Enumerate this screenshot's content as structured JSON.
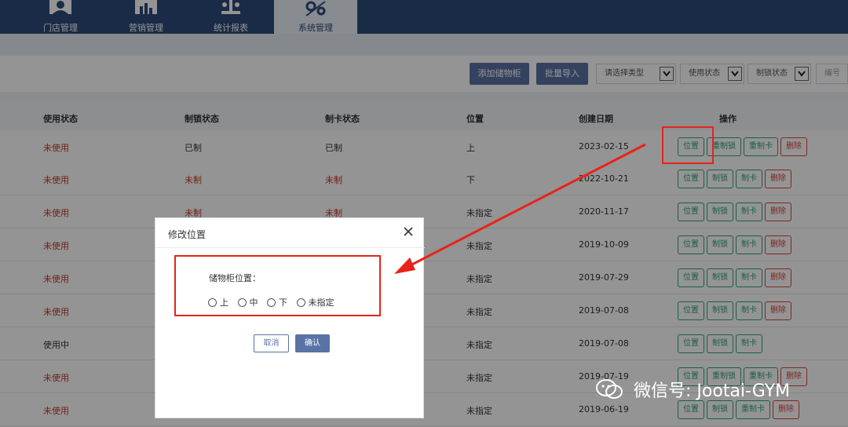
{
  "nav": {
    "tabs": [
      {
        "label": "门店管理",
        "icon": "store-manager-icon"
      },
      {
        "label": "营销管理",
        "icon": "marketing-chart-icon"
      },
      {
        "label": "统计报表",
        "icon": "statistics-icon"
      },
      {
        "label": "系统管理",
        "icon": "system-settings-icon",
        "active": true
      }
    ]
  },
  "toolbar": {
    "add_label": "添加储物柜",
    "import_label": "批量导入",
    "type_select": "请选择类型",
    "usage_select": "使用状态",
    "lock_select": "制锁状态",
    "number_input": "编号"
  },
  "table": {
    "headers": {
      "usage": "使用状态",
      "lock": "制锁状态",
      "card": "制卡状态",
      "position": "位置",
      "created": "创建日期",
      "ops": "操作"
    },
    "rows": [
      {
        "usage": "未使用",
        "lock": "已制",
        "card": "已制",
        "position": "上",
        "created": "2023-02-15",
        "ops": [
          "位置",
          "重制锁",
          "重制卡",
          "删除"
        ]
      },
      {
        "usage": "未使用",
        "lock": "未制",
        "card": "未制",
        "position": "下",
        "created": "2022-10-21",
        "ops": [
          "位置",
          "制锁",
          "制卡",
          "删除"
        ]
      },
      {
        "usage": "未使用",
        "lock": "未制",
        "card": "未制",
        "position": "未指定",
        "created": "2020-11-17",
        "ops": [
          "位置",
          "制锁",
          "制卡",
          "删除"
        ]
      },
      {
        "usage": "未使用",
        "lock": "",
        "card": "",
        "position": "未指定",
        "created": "2019-10-09",
        "ops": [
          "位置",
          "制锁",
          "制卡",
          "删除"
        ]
      },
      {
        "usage": "未使用",
        "lock": "",
        "card": "",
        "position": "未指定",
        "created": "2019-07-29",
        "ops": [
          "位置",
          "制锁",
          "制卡",
          "删除"
        ]
      },
      {
        "usage": "未使用",
        "lock": "",
        "card": "",
        "position": "未指定",
        "created": "2019-07-08",
        "ops": [
          "位置",
          "制锁",
          "制卡",
          "删除"
        ]
      },
      {
        "usage": "使用中",
        "lock": "",
        "card": "",
        "position": "未指定",
        "created": "2019-07-08",
        "ops": [
          "位置",
          "制锁",
          "制卡"
        ]
      },
      {
        "usage": "未使用",
        "lock": "",
        "card": "",
        "position": "未指定",
        "created": "2019-07-19",
        "ops": [
          "位置",
          "重制锁",
          "重制卡",
          "删除"
        ]
      },
      {
        "usage": "未使用",
        "lock": "",
        "card": "",
        "position": "未指定",
        "created": "2019-06-19",
        "ops": [
          "位置",
          "制锁",
          "重制卡",
          "删除"
        ]
      }
    ]
  },
  "dialog": {
    "title": "修改位置",
    "field_label": "储物柜位置：",
    "options": [
      "上",
      "中",
      "下",
      "未指定"
    ],
    "cancel_label": "取消",
    "ok_label": "确认"
  },
  "watermark": "微信号: Jootai-GYM",
  "colors": {
    "nav": "#2d4a7a",
    "primary": "#5a73a6",
    "green": "#2ea37a",
    "red": "#d9453c",
    "highlight": "#e8231a"
  }
}
